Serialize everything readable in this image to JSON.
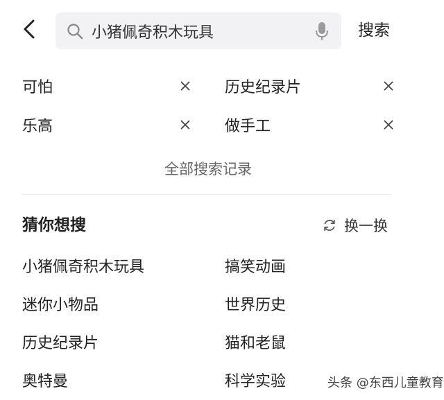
{
  "header": {
    "back_icon": "chevron-left-icon",
    "search_icon": "search-icon",
    "query": "小猪佩奇积木玩具",
    "mic_icon": "microphone-icon",
    "search_label": "搜索"
  },
  "history": {
    "items": [
      {
        "label": "可怕"
      },
      {
        "label": "历史纪录片"
      },
      {
        "label": "乐高"
      },
      {
        "label": "做手工"
      }
    ],
    "delete_icon": "close-icon",
    "all_label": "全部搜索记录"
  },
  "guess": {
    "title": "猜你想搜",
    "refresh_label": "换一换",
    "refresh_icon": "refresh-icon",
    "items": [
      "小猪佩奇积木玩具",
      "搞笑动画",
      "迷你小物品",
      "世界历史",
      "历史纪录片",
      "猫和老鼠",
      "奥特曼",
      "科学实验"
    ]
  },
  "watermark": "头条 @东西儿童教育"
}
